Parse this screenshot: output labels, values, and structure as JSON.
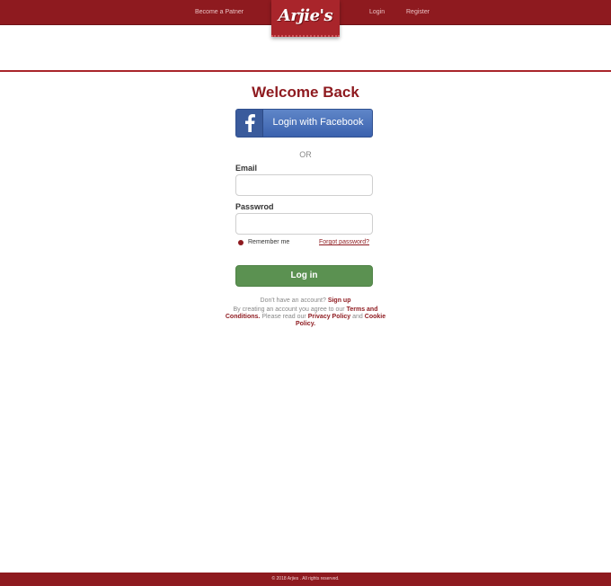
{
  "header": {
    "become_partner": "Become a Patner",
    "login": "Login",
    "register": "Register",
    "logo_text": "Arjie's"
  },
  "login_panel": {
    "title": "Welcome Back",
    "facebook_button": "Login with Facebook",
    "or_text": "OR",
    "email_label": "Email",
    "email_value": "",
    "password_label": "Passwrod",
    "password_value": "",
    "remember_me": "Remember me",
    "forgot_password": "Forgot password?",
    "login_button": "Log in",
    "no_account_text": "Don't have an account?",
    "sign_up_link": "Sign up",
    "terms_prefix": "By creating an account you agree to our",
    "terms_link": "Terms and Conditions.",
    "privacy_prefix": "Please read our",
    "privacy_link": "Privacy Policy",
    "and_text": "and",
    "cookie_link": "Cookie Policy."
  },
  "footer": {
    "copyright": "© 2018 Arjies . All rights reserved."
  },
  "colors": {
    "brand_red": "#8e1a1f",
    "facebook_blue": "#3b62ae",
    "login_green": "#5b9151"
  }
}
